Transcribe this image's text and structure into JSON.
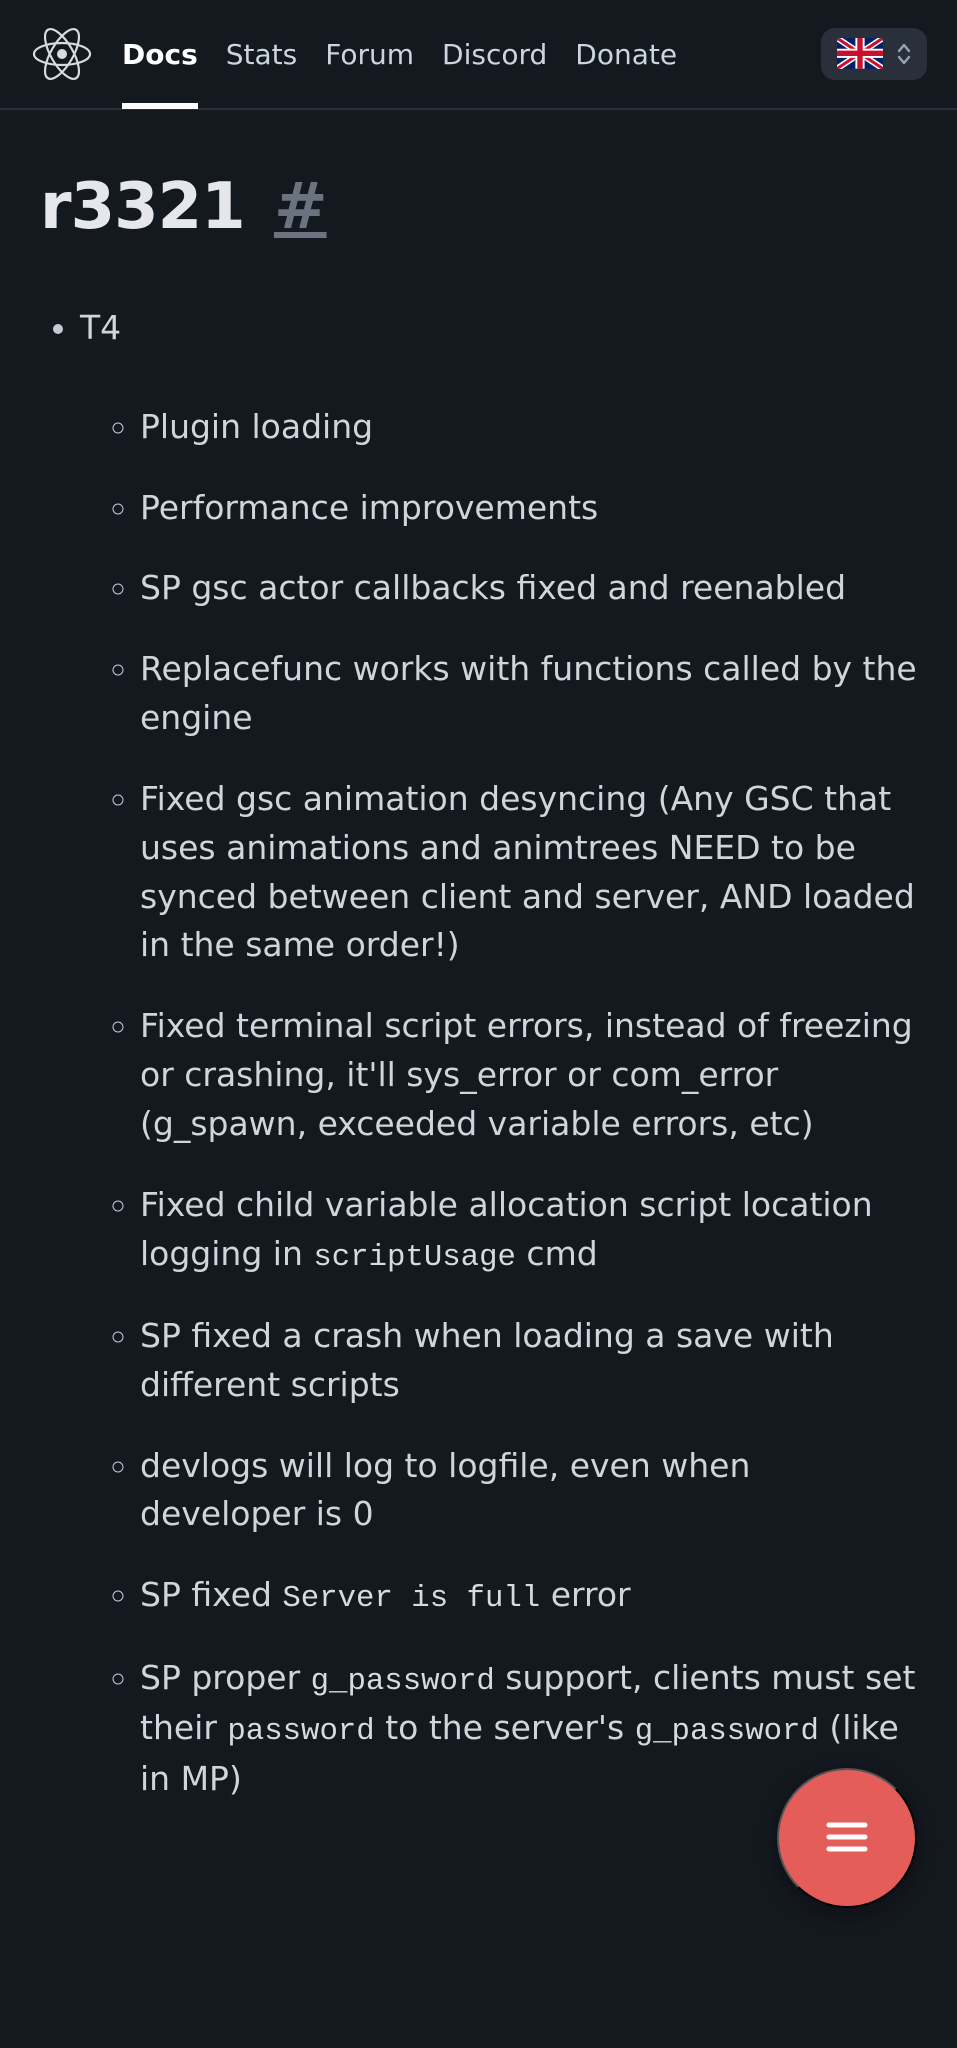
{
  "nav": {
    "items": [
      {
        "label": "Docs",
        "active": true
      },
      {
        "label": "Stats"
      },
      {
        "label": "Forum"
      },
      {
        "label": "Discord"
      },
      {
        "label": "Donate"
      }
    ]
  },
  "lang": {
    "code": "en",
    "label": "English"
  },
  "page": {
    "title": "r3321",
    "anchor": "#"
  },
  "changelog": {
    "section": "T4",
    "items": [
      {
        "text": "Plugin loading"
      },
      {
        "text": "Performance improvements"
      },
      {
        "text": "SP gsc actor callbacks fixed and reenabled"
      },
      {
        "text": "Replacefunc works with functions called by the engine"
      },
      {
        "text": "Fixed gsc animation desyncing (Any GSC that uses animations and animtrees NEED to be synced between client and server, AND loaded in the same order!)"
      },
      {
        "text": "Fixed terminal script errors, instead of freezing or crashing, it'll sys_error or com_error (g_spawn, exceeded variable errors, etc)"
      },
      {
        "pre": "Fixed child variable allocation script location logging in ",
        "code": "scriptUsage",
        "post": " cmd"
      },
      {
        "text": "SP fixed a crash when loading a save with different scripts"
      },
      {
        "text": "devlogs will log to logfile, even when developer is 0"
      },
      {
        "pre": "SP fixed ",
        "code": "Server is full",
        "post": " error"
      },
      {
        "pre": "SP proper ",
        "code": "g_password",
        "post_a": " support, clients must set their ",
        "code2": "password",
        "post_b": " to the server's ",
        "code3": "g_password",
        "post_c": " (like in MP)"
      }
    ]
  }
}
